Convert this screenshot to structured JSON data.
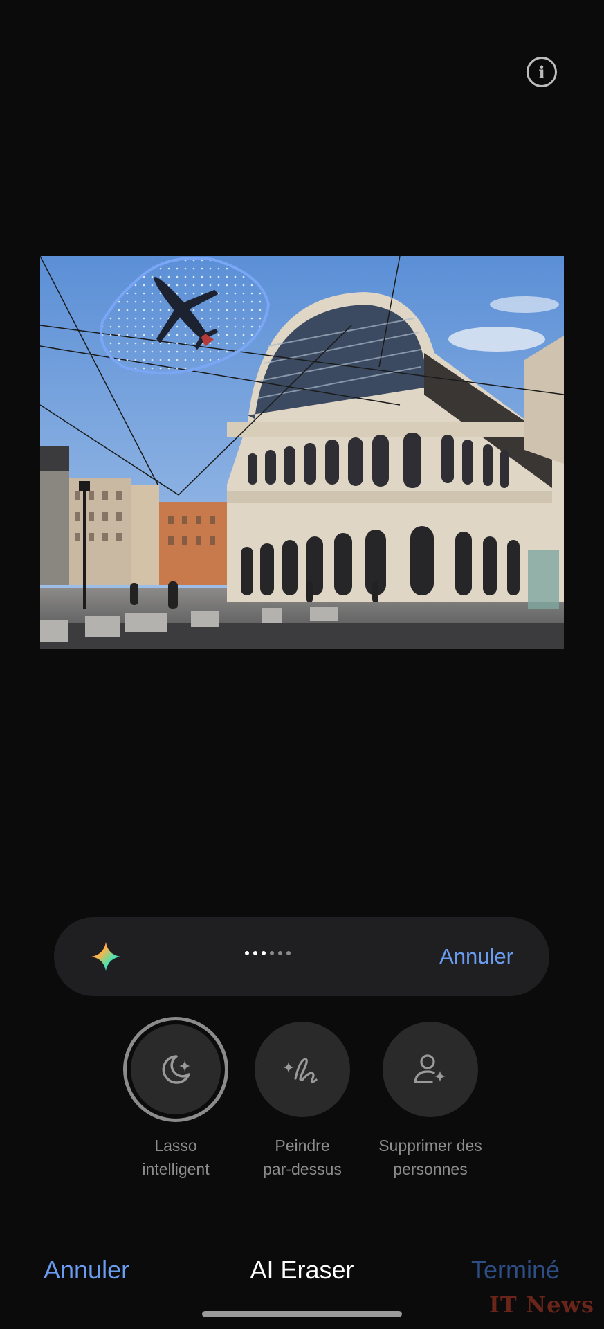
{
  "header": {
    "info_icon": "info-icon"
  },
  "photo": {
    "description_icon": "image-preview",
    "selection": "lasso-selection-airplane"
  },
  "processing_bar": {
    "icon": "sparkle-icon",
    "progress_label": "......",
    "cancel_label": "Annuler",
    "accent_color": "#6a9cf0"
  },
  "tools": [
    {
      "label": "Lasso\nintelligent",
      "icon": "smart-lasso-icon",
      "selected": true
    },
    {
      "label": "Peindre\npar-dessus",
      "icon": "paint-over-icon",
      "selected": false
    },
    {
      "label": "Supprimer des\npersonnes",
      "icon": "remove-people-icon",
      "selected": false
    }
  ],
  "bottom": {
    "cancel_label": "Annuler",
    "title": "AI Eraser",
    "done_label": "Terminé"
  },
  "watermark": "IT News"
}
